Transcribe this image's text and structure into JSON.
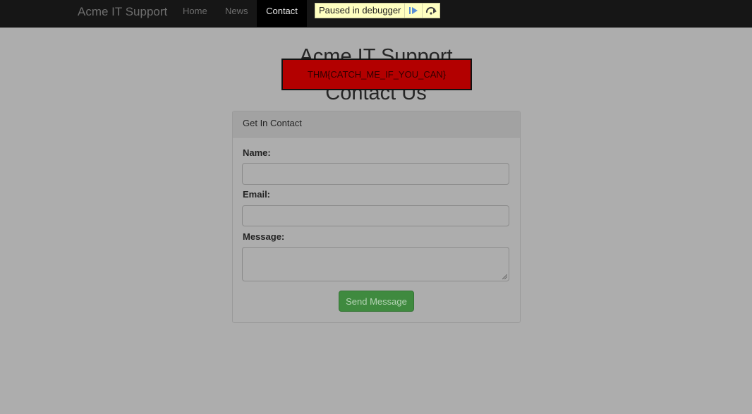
{
  "nav": {
    "brand": "Acme IT Support",
    "links": [
      "Home",
      "News",
      "Contact"
    ],
    "active": "Contact"
  },
  "debugger": {
    "label": "Paused in debugger",
    "resume_icon": "resume-icon",
    "step_over_icon": "step-over-icon"
  },
  "page": {
    "site_title": "Acme IT Support",
    "title": "Contact Us",
    "flag": "THM{CATCH_ME_IF_YOU_CAN}"
  },
  "form": {
    "panel_title": "Get In Contact",
    "name_label": "Name:",
    "name_value": "",
    "email_label": "Email:",
    "email_value": "",
    "message_label": "Message:",
    "message_value": "",
    "submit_label": "Send Message"
  },
  "colors": {
    "overlay": "#adadad",
    "navbar": "#161616",
    "flag_bg": "#b30000",
    "submit_bg": "#3f8a3f",
    "debugger_bg": "#ffffc0"
  }
}
